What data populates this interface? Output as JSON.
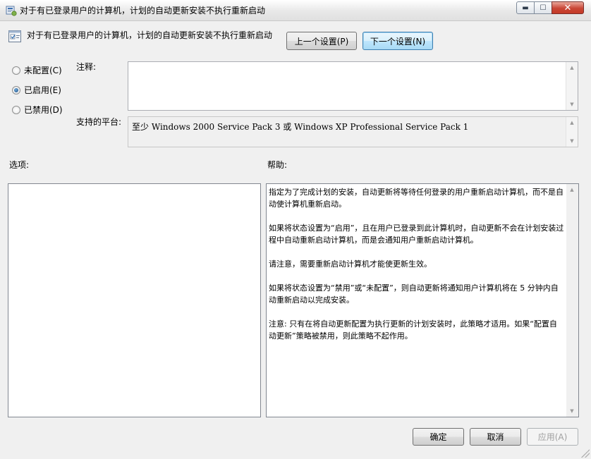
{
  "window": {
    "title": "对于有已登录用户的计算机，计划的自动更新安装不执行重新启动",
    "icon": "group-policy-setting-icon",
    "controls": {
      "minimize": "▬",
      "maximize": "☐",
      "close": "✕"
    }
  },
  "header": {
    "policy_title": "对于有已登录用户的计算机，计划的自动更新安装不执行重新启动",
    "policy_icon": "policy-setting-icon",
    "prev_button": "上一个设置(P)",
    "next_button": "下一个设置(N)"
  },
  "state": {
    "options": [
      {
        "label": "未配置(C)",
        "checked": false
      },
      {
        "label": "已启用(E)",
        "checked": true
      },
      {
        "label": "已禁用(D)",
        "checked": false
      }
    ]
  },
  "comment": {
    "label": "注释:",
    "value": ""
  },
  "platform": {
    "label": "支持的平台:",
    "value": "至少 Windows 2000 Service Pack 3 或 Windows XP Professional Service Pack 1"
  },
  "options_section": {
    "label": "选项:"
  },
  "help_section": {
    "label": "帮助:",
    "paragraphs": [
      "指定为了完成计划的安装，自动更新将等待任何登录的用户重新启动计算机，而不是自动使计算机重新启动。",
      "如果将状态设置为“启用”，且在用户已登录到此计算机时，自动更新不会在计划安装过程中自动重新启动计算机，而是会通知用户重新启动计算机。",
      "请注意，需要重新启动计算机才能使更新生效。",
      "如果将状态设置为“禁用”或“未配置”，则自动更新将通知用户计算机将在 5 分钟内自动重新启动以完成安装。",
      "注意: 只有在将自动更新配置为执行更新的计划安装时，此策略才适用。如果“配置自动更新”策略被禁用，则此策略不起作用。"
    ]
  },
  "footer": {
    "ok_button": "确定",
    "cancel_button": "取消",
    "apply_button": "应用(A)"
  }
}
